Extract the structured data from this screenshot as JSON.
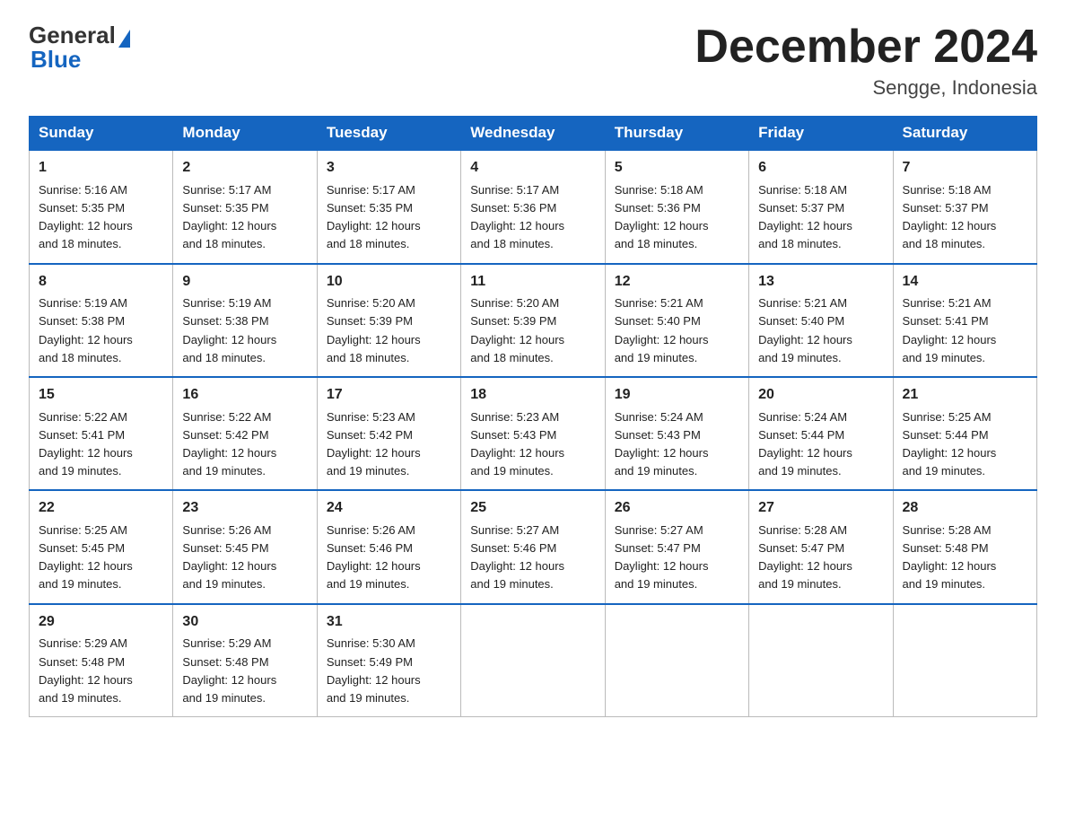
{
  "logo": {
    "general": "General",
    "arrow": "▶",
    "blue": "Blue"
  },
  "title": "December 2024",
  "location": "Sengge, Indonesia",
  "weekdays": [
    "Sunday",
    "Monday",
    "Tuesday",
    "Wednesday",
    "Thursday",
    "Friday",
    "Saturday"
  ],
  "weeks": [
    [
      {
        "day": "1",
        "sunrise": "5:16 AM",
        "sunset": "5:35 PM",
        "daylight": "12 hours and 18 minutes."
      },
      {
        "day": "2",
        "sunrise": "5:17 AM",
        "sunset": "5:35 PM",
        "daylight": "12 hours and 18 minutes."
      },
      {
        "day": "3",
        "sunrise": "5:17 AM",
        "sunset": "5:35 PM",
        "daylight": "12 hours and 18 minutes."
      },
      {
        "day": "4",
        "sunrise": "5:17 AM",
        "sunset": "5:36 PM",
        "daylight": "12 hours and 18 minutes."
      },
      {
        "day": "5",
        "sunrise": "5:18 AM",
        "sunset": "5:36 PM",
        "daylight": "12 hours and 18 minutes."
      },
      {
        "day": "6",
        "sunrise": "5:18 AM",
        "sunset": "5:37 PM",
        "daylight": "12 hours and 18 minutes."
      },
      {
        "day": "7",
        "sunrise": "5:18 AM",
        "sunset": "5:37 PM",
        "daylight": "12 hours and 18 minutes."
      }
    ],
    [
      {
        "day": "8",
        "sunrise": "5:19 AM",
        "sunset": "5:38 PM",
        "daylight": "12 hours and 18 minutes."
      },
      {
        "day": "9",
        "sunrise": "5:19 AM",
        "sunset": "5:38 PM",
        "daylight": "12 hours and 18 minutes."
      },
      {
        "day": "10",
        "sunrise": "5:20 AM",
        "sunset": "5:39 PM",
        "daylight": "12 hours and 18 minutes."
      },
      {
        "day": "11",
        "sunrise": "5:20 AM",
        "sunset": "5:39 PM",
        "daylight": "12 hours and 18 minutes."
      },
      {
        "day": "12",
        "sunrise": "5:21 AM",
        "sunset": "5:40 PM",
        "daylight": "12 hours and 19 minutes."
      },
      {
        "day": "13",
        "sunrise": "5:21 AM",
        "sunset": "5:40 PM",
        "daylight": "12 hours and 19 minutes."
      },
      {
        "day": "14",
        "sunrise": "5:21 AM",
        "sunset": "5:41 PM",
        "daylight": "12 hours and 19 minutes."
      }
    ],
    [
      {
        "day": "15",
        "sunrise": "5:22 AM",
        "sunset": "5:41 PM",
        "daylight": "12 hours and 19 minutes."
      },
      {
        "day": "16",
        "sunrise": "5:22 AM",
        "sunset": "5:42 PM",
        "daylight": "12 hours and 19 minutes."
      },
      {
        "day": "17",
        "sunrise": "5:23 AM",
        "sunset": "5:42 PM",
        "daylight": "12 hours and 19 minutes."
      },
      {
        "day": "18",
        "sunrise": "5:23 AM",
        "sunset": "5:43 PM",
        "daylight": "12 hours and 19 minutes."
      },
      {
        "day": "19",
        "sunrise": "5:24 AM",
        "sunset": "5:43 PM",
        "daylight": "12 hours and 19 minutes."
      },
      {
        "day": "20",
        "sunrise": "5:24 AM",
        "sunset": "5:44 PM",
        "daylight": "12 hours and 19 minutes."
      },
      {
        "day": "21",
        "sunrise": "5:25 AM",
        "sunset": "5:44 PM",
        "daylight": "12 hours and 19 minutes."
      }
    ],
    [
      {
        "day": "22",
        "sunrise": "5:25 AM",
        "sunset": "5:45 PM",
        "daylight": "12 hours and 19 minutes."
      },
      {
        "day": "23",
        "sunrise": "5:26 AM",
        "sunset": "5:45 PM",
        "daylight": "12 hours and 19 minutes."
      },
      {
        "day": "24",
        "sunrise": "5:26 AM",
        "sunset": "5:46 PM",
        "daylight": "12 hours and 19 minutes."
      },
      {
        "day": "25",
        "sunrise": "5:27 AM",
        "sunset": "5:46 PM",
        "daylight": "12 hours and 19 minutes."
      },
      {
        "day": "26",
        "sunrise": "5:27 AM",
        "sunset": "5:47 PM",
        "daylight": "12 hours and 19 minutes."
      },
      {
        "day": "27",
        "sunrise": "5:28 AM",
        "sunset": "5:47 PM",
        "daylight": "12 hours and 19 minutes."
      },
      {
        "day": "28",
        "sunrise": "5:28 AM",
        "sunset": "5:48 PM",
        "daylight": "12 hours and 19 minutes."
      }
    ],
    [
      {
        "day": "29",
        "sunrise": "5:29 AM",
        "sunset": "5:48 PM",
        "daylight": "12 hours and 19 minutes."
      },
      {
        "day": "30",
        "sunrise": "5:29 AM",
        "sunset": "5:48 PM",
        "daylight": "12 hours and 19 minutes."
      },
      {
        "day": "31",
        "sunrise": "5:30 AM",
        "sunset": "5:49 PM",
        "daylight": "12 hours and 19 minutes."
      },
      null,
      null,
      null,
      null
    ]
  ]
}
